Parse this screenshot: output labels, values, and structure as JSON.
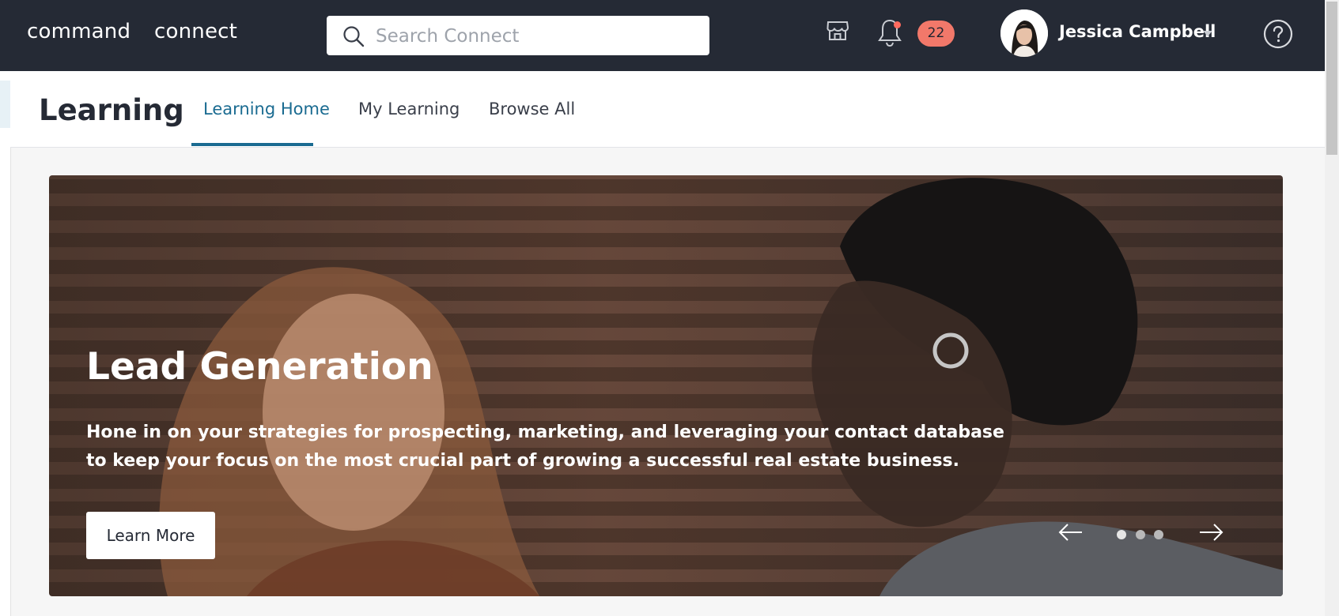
{
  "nav": {
    "brand_left": "command",
    "brand_right": "connect",
    "search_placeholder": "Search Connect",
    "notification_count": "22",
    "user_name": "Jessica Campbell"
  },
  "learning": {
    "title": "Learning",
    "tabs": [
      {
        "label": "Learning Home",
        "active": true
      },
      {
        "label": "My Learning",
        "active": false
      },
      {
        "label": "Browse All",
        "active": false
      }
    ]
  },
  "hero": {
    "title": "Lead Generation",
    "description": "Hone in on your strategies for prospecting, marketing, and leveraging your contact database to keep your focus on the most crucial part of growing a successful real estate business.",
    "button_label": "Learn More",
    "slides_total": 3,
    "active_slide": 1
  },
  "colors": {
    "topbar": "#252a35",
    "accent": "#1a6b91",
    "badge": "#f2786a"
  },
  "icons": [
    "search-icon",
    "store-icon",
    "bell-icon",
    "caret-down-icon",
    "help-icon",
    "arrow-left-icon",
    "arrow-right-icon"
  ]
}
